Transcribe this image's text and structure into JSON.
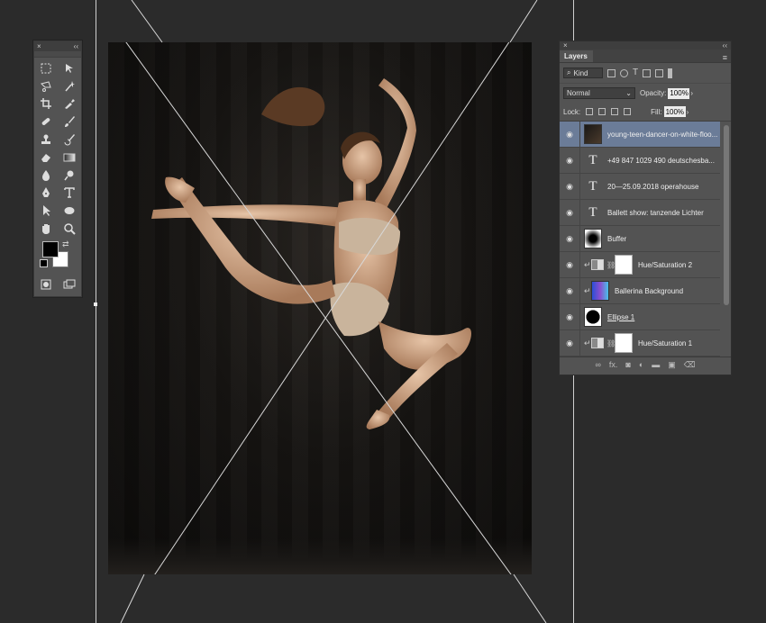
{
  "canvas": {
    "description_icon": "dancer-photo"
  },
  "tools_panel": {
    "close_glyph": "×",
    "collapse_glyph": "‹‹",
    "tools": [
      "marquee-icon",
      "move-icon",
      "lasso-icon",
      "magic-wand-icon",
      "crop-icon",
      "eyedropper-icon",
      "healing-brush-icon",
      "brush-icon",
      "clone-stamp-icon",
      "history-brush-icon",
      "eraser-icon",
      "gradient-icon",
      "blur-icon",
      "dodge-icon",
      "pen-icon",
      "type-icon",
      "path-select-icon",
      "ellipse-icon",
      "hand-icon",
      "zoom-icon"
    ],
    "swap_glyph": "⇄"
  },
  "layers_panel": {
    "close_glyph": "×",
    "collapse_glyph": "‹‹",
    "tab_label": "Layers",
    "menu_glyph": "≡",
    "filter_kind": "Kind",
    "blend_mode": "Normal",
    "opacity_label": "Opacity:",
    "opacity_value": "100%",
    "lock_label": "Lock:",
    "fill_label": "Fill:",
    "fill_value": "100%",
    "layers": [
      {
        "name": "young-teen-dancer-on-white-floo...",
        "type": "smart",
        "selected": true
      },
      {
        "name": "+49 847 1029 490 deutschesba...",
        "type": "text"
      },
      {
        "name": "20—25.09.2018 operahouse",
        "type": "text"
      },
      {
        "name": "Ballett show: tanzende Lichter",
        "type": "text"
      },
      {
        "name": "Buffer",
        "type": "pixel"
      },
      {
        "name": "Hue/Saturation 2",
        "type": "adjustment"
      },
      {
        "name": "Ballerina Background",
        "type": "gradient"
      },
      {
        "name": "Ellipse 1",
        "type": "shape"
      },
      {
        "name": "Hue/Saturation 1",
        "type": "adjustment"
      }
    ],
    "footer_icons": [
      "link-icon",
      "fx-icon",
      "mask-icon",
      "adjustment-icon",
      "folder-icon",
      "new-layer-icon",
      "trash-icon"
    ],
    "footer_fx": "fx."
  }
}
